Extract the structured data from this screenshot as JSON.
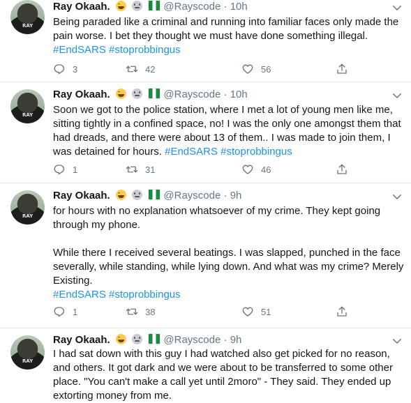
{
  "tweets": [
    {
      "name": "Ray Okaah.",
      "handle": "@Rayscode",
      "sep": "·",
      "time": "10h",
      "avatar_text": "RAY",
      "text": "Being paraded like a criminal and running into familiar faces only made the pain worse. I bet they thought we must have done something illegal.",
      "tags": "#EndSARS #stoprobbingus",
      "replies": "3",
      "retweets": "42",
      "likes": "56"
    },
    {
      "name": "Ray Okaah.",
      "handle": "@Rayscode",
      "sep": "·",
      "time": "10h",
      "avatar_text": "RAY",
      "text": "Soon we got to the police station, where I met a lot of young men like me, sitting tightly in a confined space, no! I was the only one amongst them that had dreads, and there were about 13 of them.. I was made to join them, I was detained for hours.",
      "tags": "#EndSARS #stoprobbingus",
      "replies": "1",
      "retweets": "31",
      "likes": "46"
    },
    {
      "name": "Ray Okaah.",
      "handle": "@Rayscode",
      "sep": "·",
      "time": "9h",
      "avatar_text": "RAY",
      "text": "for hours with no explanation whatsoever of my crime. They kept going through my phone.\n\nWhile there I received several beatings. I was slapped, punched in the face severally, while standing, while lying down. And what was my crime? Merely Existing.",
      "tags": "#EndSARS #stoprobbingus",
      "replies": "1",
      "retweets": "38",
      "likes": "51"
    },
    {
      "name": "Ray Okaah.",
      "handle": "@Rayscode",
      "sep": "·",
      "time": "9h",
      "avatar_text": "RAY",
      "text": "I had sat down with this guy I had watched also get picked for no reason, and others. It got dark and we were about to be transferred to some other place. \"You can't make a call yet until 2moro\" - They said. They ended up extorting money from me."
    }
  ],
  "colors": {
    "link": "#1b95e0",
    "muted": "#657786",
    "text": "#14171a",
    "divider": "#e6ecf0"
  },
  "icons": [
    "reply-icon",
    "retweet-icon",
    "like-icon",
    "share-icon",
    "chevron-down-icon",
    "laughing-emoji-icon",
    "grinning-emoji-icon",
    "nigeria-flag-icon"
  ]
}
